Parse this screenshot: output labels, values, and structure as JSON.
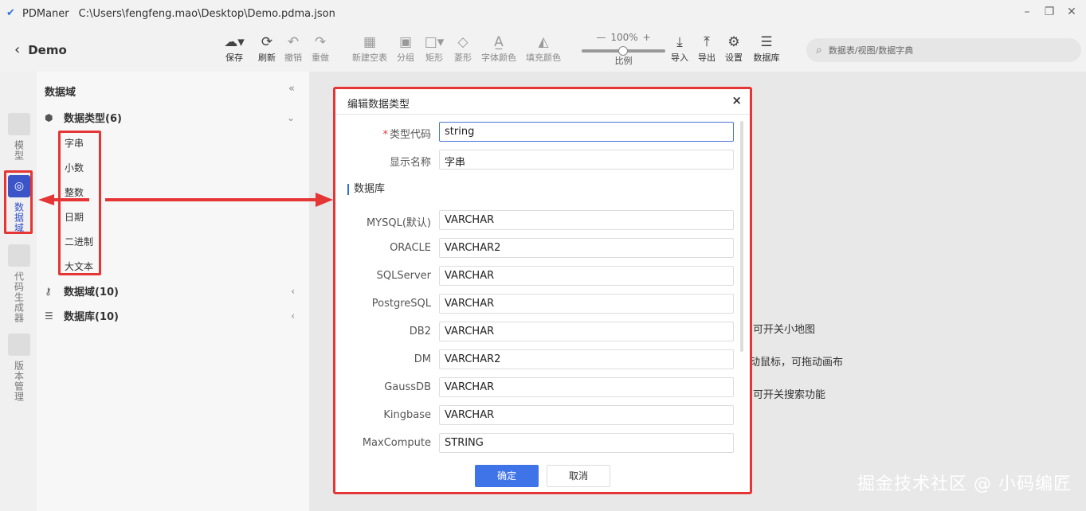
{
  "titlebar": {
    "app_name": "PDManer",
    "path": "C:\\Users\\fengfeng.mao\\Desktop\\Demo.pdma.json"
  },
  "toolbar": {
    "back_label": "Demo",
    "tools": [
      {
        "label": "保存",
        "icon": "upload-cloud-icon"
      },
      {
        "label": "刷新",
        "icon": "refresh-icon"
      },
      {
        "label": "撤销",
        "icon": "undo-icon"
      },
      {
        "label": "重做",
        "icon": "redo-icon"
      },
      {
        "label": "新建空表",
        "icon": "new-table-icon"
      },
      {
        "label": "分组",
        "icon": "group-icon"
      },
      {
        "label": "矩形",
        "icon": "rectangle-icon"
      },
      {
        "label": "菱形",
        "icon": "diamond-icon"
      },
      {
        "label": "字体颜色",
        "icon": "font-color-icon"
      },
      {
        "label": "填充颜色",
        "icon": "fill-color-icon"
      },
      {
        "label": "导入",
        "icon": "import-icon"
      },
      {
        "label": "导出",
        "icon": "export-icon"
      },
      {
        "label": "设置",
        "icon": "gear-icon"
      },
      {
        "label": "数据库",
        "icon": "database-icon"
      }
    ],
    "zoom": {
      "minus": "—",
      "value": "100%",
      "plus": "+",
      "label": "比例"
    },
    "search_placeholder": "数据表/视图/数据字典"
  },
  "leftnav": {
    "items": [
      {
        "label": "模型"
      },
      {
        "label": "数据域"
      },
      {
        "label": "代码生成器"
      },
      {
        "label": "版本管理"
      }
    ]
  },
  "sidebar": {
    "title": "数据域",
    "collapse": "«",
    "groups": [
      {
        "label": "数据类型(6)",
        "items": [
          "字串",
          "小数",
          "整数",
          "日期",
          "二进制",
          "大文本"
        ]
      },
      {
        "label": "数据域(10)"
      },
      {
        "label": "数据库(10)"
      }
    ]
  },
  "canvas": {
    "hints": [
      "可开关小地图",
      "动鼠标，可拖动画布",
      "可开关搜索功能"
    ],
    "watermark": "掘金技术社区 @ 小码编匠"
  },
  "dialog": {
    "title": "编辑数据类型",
    "close": "×",
    "type_code": {
      "label": "类型代码",
      "required_mark": "*",
      "value": "string"
    },
    "display_name": {
      "label": "显示名称",
      "value": "字串"
    },
    "section_title": "数据库",
    "db_types": [
      {
        "db": "MYSQL(默认)",
        "type": "VARCHAR"
      },
      {
        "db": "ORACLE",
        "type": "VARCHAR2"
      },
      {
        "db": "SQLServer",
        "type": "VARCHAR"
      },
      {
        "db": "PostgreSQL",
        "type": "VARCHAR"
      },
      {
        "db": "DB2",
        "type": "VARCHAR"
      },
      {
        "db": "DM",
        "type": "VARCHAR2"
      },
      {
        "db": "GaussDB",
        "type": "VARCHAR"
      },
      {
        "db": "Kingbase",
        "type": "VARCHAR"
      },
      {
        "db": "MaxCompute",
        "type": "STRING"
      }
    ],
    "ok_label": "确定",
    "cancel_label": "取消"
  },
  "colors": {
    "accent": "#3f73e8",
    "highlight_red": "#e53535",
    "nav_active": "#3b55c8"
  }
}
